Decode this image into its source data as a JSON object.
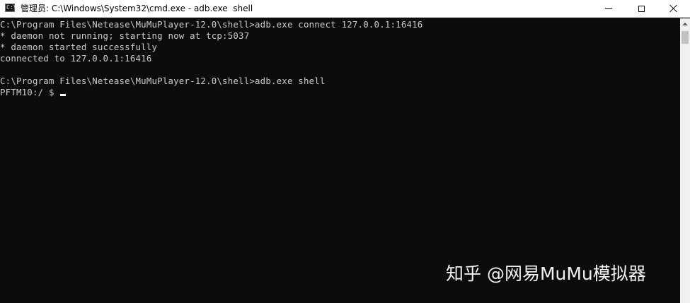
{
  "window": {
    "title": "管理员: C:\\Windows\\System32\\cmd.exe - adb.exe  shell",
    "icon": "cmd-console-icon",
    "buttons": {
      "minimize": "minimize-icon",
      "maximize": "maximize-icon",
      "close": "close-icon"
    }
  },
  "console": {
    "lines": [
      "C:\\Program Files\\Netease\\MuMuPlayer-12.0\\shell>adb.exe connect 127.0.0.1:16416",
      "* daemon not running; starting now at tcp:5037",
      "* daemon started successfully",
      "connected to 127.0.0.1:16416",
      "",
      "C:\\Program Files\\Netease\\MuMuPlayer-12.0\\shell>adb.exe shell"
    ],
    "prompt": "PFTM10:/ $ "
  },
  "watermark": "知乎 @网易MuMu模拟器",
  "colors": {
    "background": "#0c0c0c",
    "text": "#cccccc",
    "titlebar": "#ffffff"
  }
}
